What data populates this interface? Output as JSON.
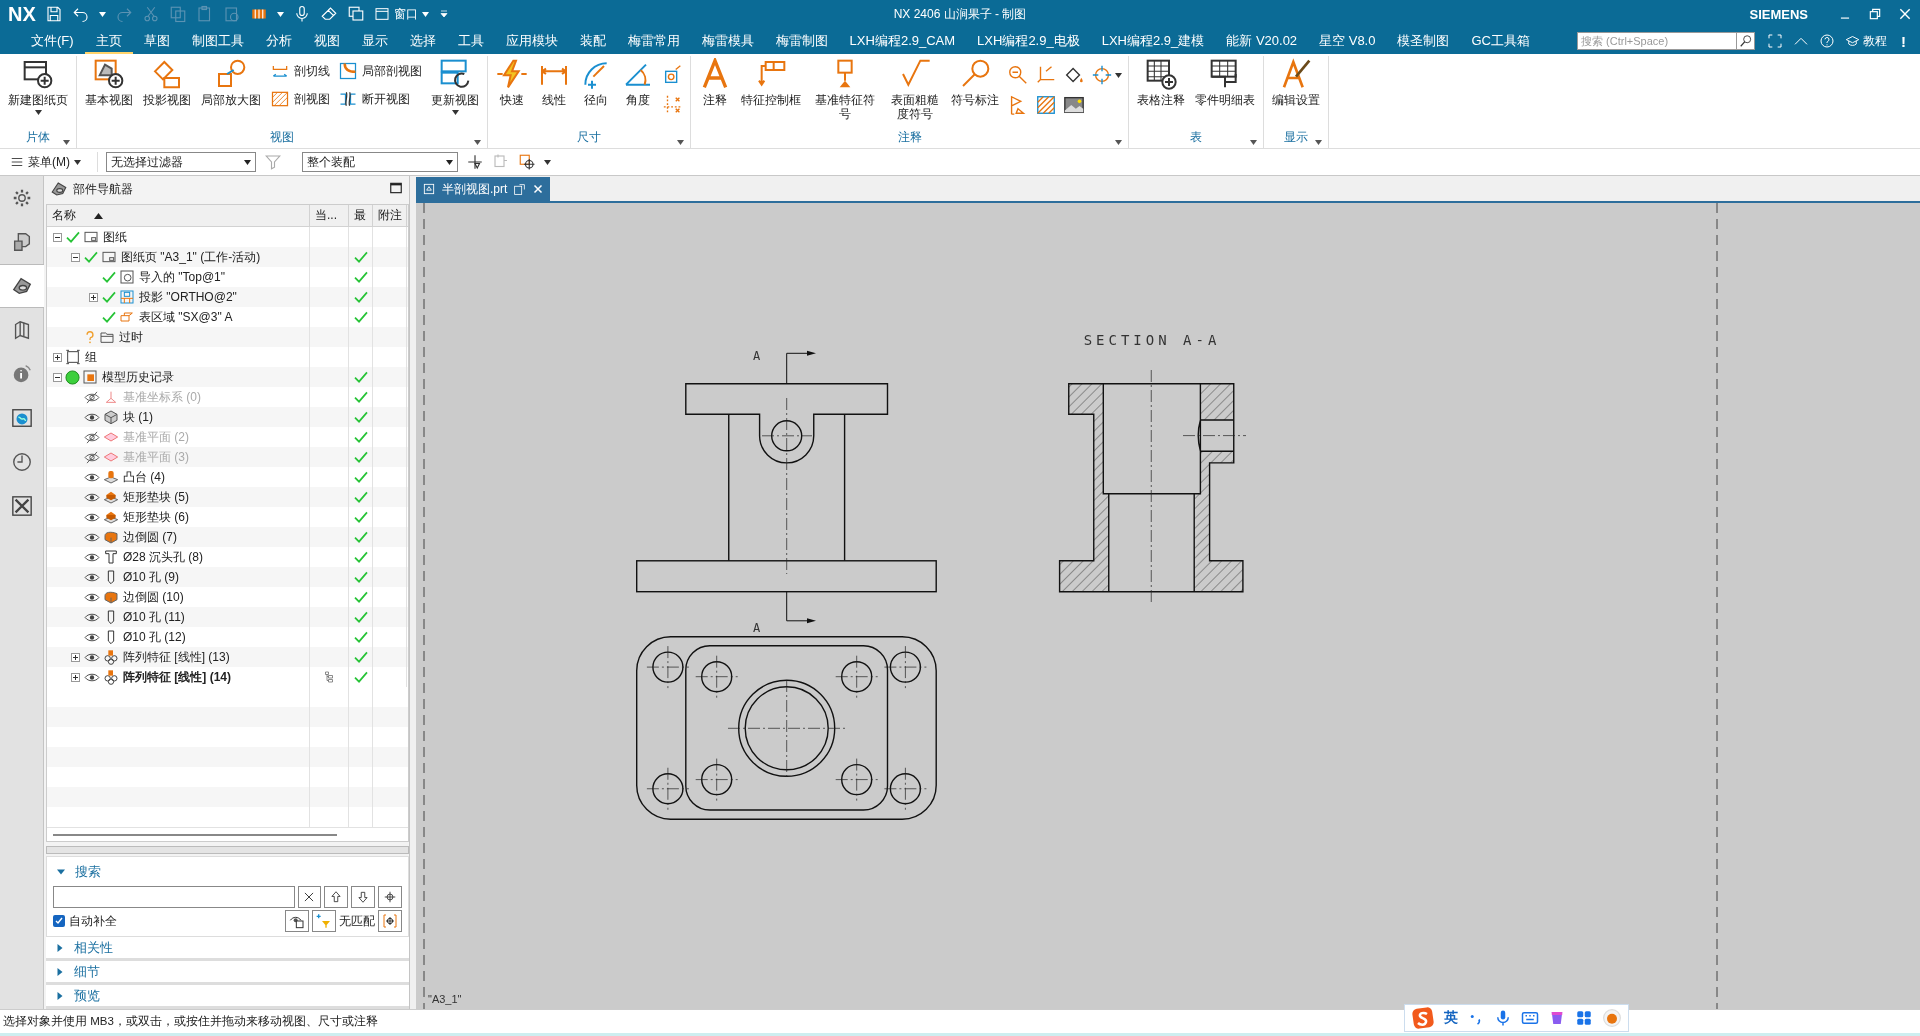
{
  "title_bar": {
    "logo": "NX",
    "window_menu": "窗口",
    "title": "NX 2406 山涧果子 - 制图",
    "brand": "SIEMENS"
  },
  "menu_tabs": [
    {
      "label": "文件(F)",
      "selected": false
    },
    {
      "label": "主页",
      "selected": true
    },
    {
      "label": "草图",
      "selected": false
    },
    {
      "label": "制图工具",
      "selected": false
    },
    {
      "label": "分析",
      "selected": false
    },
    {
      "label": "视图",
      "selected": false
    },
    {
      "label": "显示",
      "selected": false
    },
    {
      "label": "选择",
      "selected": false
    },
    {
      "label": "工具",
      "selected": false
    },
    {
      "label": "应用模块",
      "selected": false
    },
    {
      "label": "装配",
      "selected": false
    },
    {
      "label": "梅雷常用",
      "selected": false
    },
    {
      "label": "梅雷模具",
      "selected": false
    },
    {
      "label": "梅雷制图",
      "selected": false
    },
    {
      "label": "LXH编程2.9_CAM",
      "selected": false
    },
    {
      "label": "LXH编程2.9_电极",
      "selected": false
    },
    {
      "label": "LXH编程2.9_建模",
      "selected": false
    },
    {
      "label": "能新 V20.02",
      "selected": false
    },
    {
      "label": "星空 V8.0",
      "selected": false
    },
    {
      "label": "模圣制图",
      "selected": false
    },
    {
      "label": "GC工具箱",
      "selected": false
    }
  ],
  "search": {
    "placeholder": "搜索 (Ctrl+Space)"
  },
  "help": {
    "tutorial": "教程",
    "alert": "!"
  },
  "ribbon": {
    "groups": [
      {
        "label": "片体",
        "items": [
          {
            "kind": "large",
            "label": "新建图纸页",
            "dropdown": true
          }
        ]
      },
      {
        "label": "视图",
        "items": [
          {
            "kind": "large",
            "label": "基本视图"
          },
          {
            "kind": "large",
            "label": "投影视图"
          },
          {
            "kind": "large",
            "label": "局部放大图"
          },
          {
            "kind": "small",
            "label": "剖切线"
          },
          {
            "kind": "small",
            "label": "剖视图"
          },
          {
            "kind": "small",
            "label": "局部剖视图"
          },
          {
            "kind": "small",
            "label": "断开视图"
          },
          {
            "kind": "large",
            "label": "更新视图",
            "dropdown": true
          }
        ]
      },
      {
        "label": "尺寸",
        "items": [
          {
            "kind": "large",
            "label": "快速"
          },
          {
            "kind": "large",
            "label": "线性"
          },
          {
            "kind": "large",
            "label": "径向"
          },
          {
            "kind": "large",
            "label": "角度"
          },
          {
            "kind": "icon"
          },
          {
            "kind": "icon"
          }
        ]
      },
      {
        "label": "注释",
        "items": [
          {
            "kind": "large",
            "label": "注释"
          },
          {
            "kind": "large",
            "label": "特征控制框"
          },
          {
            "kind": "large",
            "label": "基准特征符号"
          },
          {
            "kind": "large",
            "label": "表面粗糙度符号"
          },
          {
            "kind": "large",
            "label": "符号标注"
          },
          {
            "kind": "icon"
          },
          {
            "kind": "icon"
          },
          {
            "kind": "icon"
          },
          {
            "kind": "icon"
          },
          {
            "kind": "icon"
          },
          {
            "kind": "icon"
          },
          {
            "kind": "icon",
            "dropdown": true
          }
        ]
      },
      {
        "label": "表",
        "items": [
          {
            "kind": "large",
            "label": "表格注释"
          },
          {
            "kind": "large",
            "label": "零件明细表"
          }
        ]
      },
      {
        "label": "显示",
        "items": [
          {
            "kind": "large",
            "label": "编辑设置"
          }
        ]
      }
    ]
  },
  "toolbar": {
    "menu": "菜单(M)",
    "selection_filter": "无选择过滤器",
    "scope": "整个装配"
  },
  "resource_bar": [
    {
      "selected": false
    },
    {
      "selected": false
    },
    {
      "selected": true
    },
    {
      "selected": false
    },
    {
      "selected": false
    },
    {
      "selected": false
    },
    {
      "selected": false
    },
    {
      "selected": false
    }
  ],
  "navigator": {
    "title": "部件导航器",
    "columns": [
      "名称",
      "当...",
      "最",
      "附注"
    ],
    "tree": [
      {
        "kind": "drawing",
        "label": "图纸",
        "expanded": true,
        "checked": true,
        "latest": false,
        "children": [
          {
            "kind": "sheet",
            "label": "图纸页 \"A3_1\" (工作-活动)",
            "expanded": true,
            "checked": true,
            "latest": true,
            "children": [
              {
                "kind": "imported_view",
                "label": "导入的 \"Top@1\"",
                "checked": true,
                "latest": true
              },
              {
                "kind": "projected_view",
                "label": "投影 \"ORTHO@2\"",
                "expanded": false,
                "checked": true,
                "latest": true
              },
              {
                "kind": "table_region",
                "label": "表区域 \"SX@3\" A",
                "checked": true,
                "latest": true
              }
            ]
          },
          {
            "kind": "outdated",
            "label": "过时",
            "latest": false
          }
        ]
      },
      {
        "kind": "group",
        "label": "组",
        "expanded": false,
        "latest": false
      },
      {
        "kind": "history",
        "label": "模型历史记录",
        "expanded": true,
        "latest": true,
        "children": [
          {
            "kind": "csys",
            "label": "基准坐标系 (0)",
            "visible": false,
            "latest": true,
            "current": false
          },
          {
            "kind": "block",
            "label": "块 (1)",
            "visible": true,
            "latest": true,
            "current": false
          },
          {
            "kind": "plane",
            "label": "基准平面 (2)",
            "visible": false,
            "latest": true,
            "current": false
          },
          {
            "kind": "plane",
            "label": "基准平面 (3)",
            "visible": false,
            "latest": true,
            "current": false
          },
          {
            "kind": "boss",
            "label": "凸台 (4)",
            "visible": true,
            "latest": true,
            "current": false
          },
          {
            "kind": "pad",
            "label": "矩形垫块 (5)",
            "visible": true,
            "latest": true,
            "current": false
          },
          {
            "kind": "pad",
            "label": "矩形垫块 (6)",
            "visible": true,
            "latest": true,
            "current": false
          },
          {
            "kind": "blend",
            "label": "边倒圆 (7)",
            "visible": true,
            "latest": true,
            "current": false
          },
          {
            "kind": "counterbore",
            "label": "Ø28 沉头孔 (8)",
            "visible": true,
            "latest": true,
            "current": false
          },
          {
            "kind": "hole",
            "label": "Ø10 孔 (9)",
            "visible": true,
            "latest": true,
            "current": false
          },
          {
            "kind": "blend",
            "label": "边倒圆 (10)",
            "visible": true,
            "latest": true,
            "current": false
          },
          {
            "kind": "hole",
            "label": "Ø10 孔 (11)",
            "visible": true,
            "latest": true,
            "current": false
          },
          {
            "kind": "hole",
            "label": "Ø10 孔 (12)",
            "visible": true,
            "latest": true,
            "current": false
          },
          {
            "kind": "pattern",
            "label": "阵列特征 [线性] (13)",
            "expanded": false,
            "visible": true,
            "latest": true,
            "current": false
          },
          {
            "kind": "pattern",
            "label": "阵列特征 [线性] (14)",
            "expanded": false,
            "visible": true,
            "latest": true,
            "current": true
          }
        ]
      }
    ]
  },
  "search_panel": {
    "sections": [
      {
        "label": "搜索",
        "expanded": true
      },
      {
        "label": "相关性",
        "expanded": false
      },
      {
        "label": "细节",
        "expanded": false
      },
      {
        "label": "预览",
        "expanded": false
      }
    ],
    "auto_complete": {
      "label": "自动补全",
      "checked": true
    },
    "match_status": "无匹配"
  },
  "document": {
    "tab": {
      "label": "半剖视图.prt",
      "selected": true
    },
    "sheet_label": "\"A3_1\"",
    "section_title": "SECTION A-A",
    "cut_labels": [
      "A",
      "A"
    ]
  },
  "status_bar": {
    "message": "选择对象并使用 MB3，或双击，或按住并拖动来移动视图、尺寸或注释",
    "ime_mode": "英"
  }
}
